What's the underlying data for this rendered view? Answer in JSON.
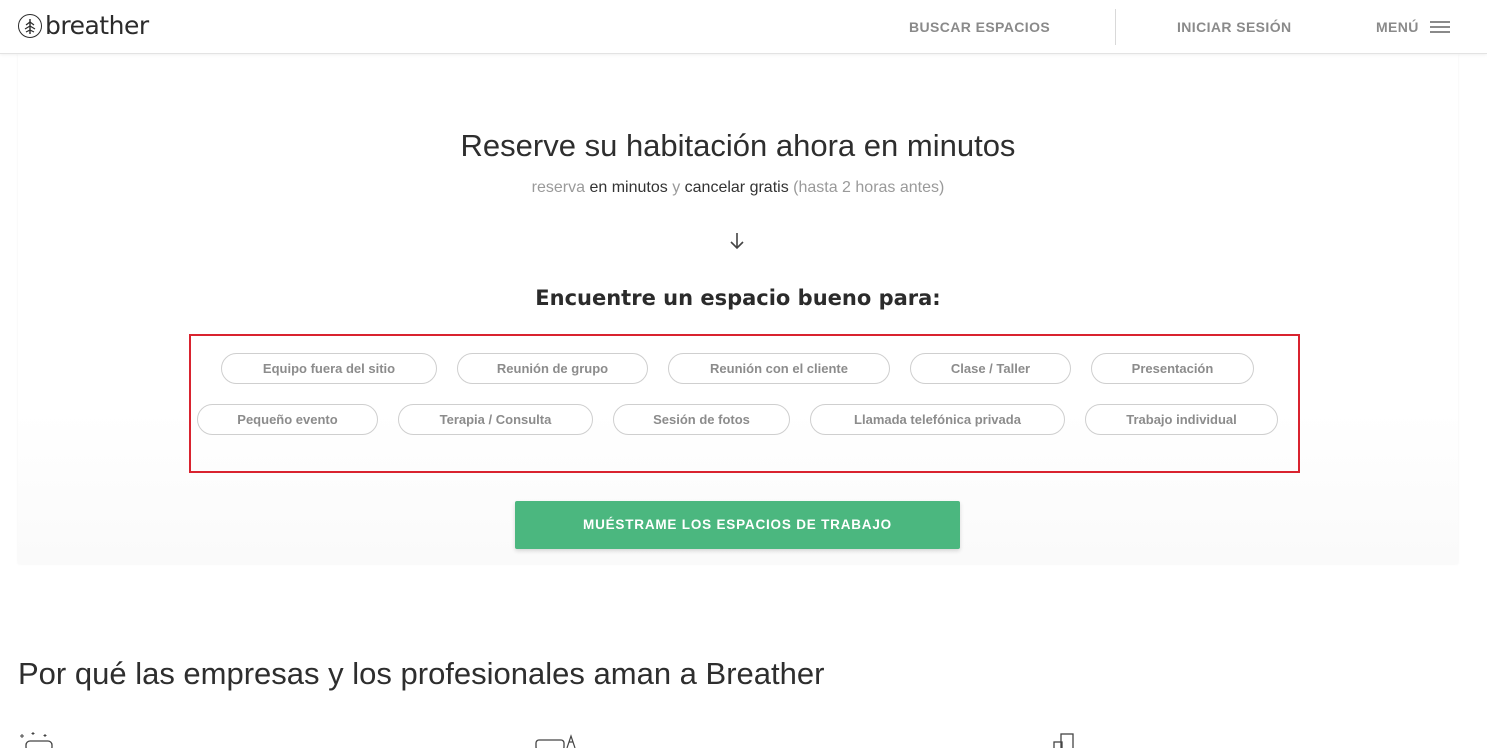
{
  "header": {
    "logo_text": "breather",
    "search_label": "BUSCAR ESPACIOS",
    "login_label": "INICIAR SESIÓN",
    "menu_label": "MENÚ"
  },
  "hero": {
    "title": "Reserve su habitación ahora en minutos",
    "subtitle": {
      "part1": "reserva",
      "part2": "en minutos",
      "part3": "y",
      "part4": "cancelar gratis",
      "part5": "(hasta 2 horas antes)"
    },
    "find_title": "Encuentre un espacio bueno para:",
    "chips": [
      "Equipo fuera del sitio",
      "Reunión de grupo",
      "Reunión con el cliente",
      "Clase / Taller",
      "Presentación",
      "Pequeño evento",
      "Terapia / Consulta",
      "Sesión de fotos",
      "Llamada telefónica privada",
      "Trabajo individual"
    ],
    "cta_label": "MUÉSTRAME LOS ESPACIOS DE TRABAJO"
  },
  "why": {
    "title": "Por qué las empresas y los profesionales aman a Breather"
  },
  "colors": {
    "accent_green": "#4bb77f",
    "highlight_red": "#d9232f"
  },
  "icons": [
    "tree-logo-icon",
    "hamburger-icon",
    "arrow-down-icon",
    "sparkle-icon",
    "furniture-icon",
    "building-icon"
  ]
}
